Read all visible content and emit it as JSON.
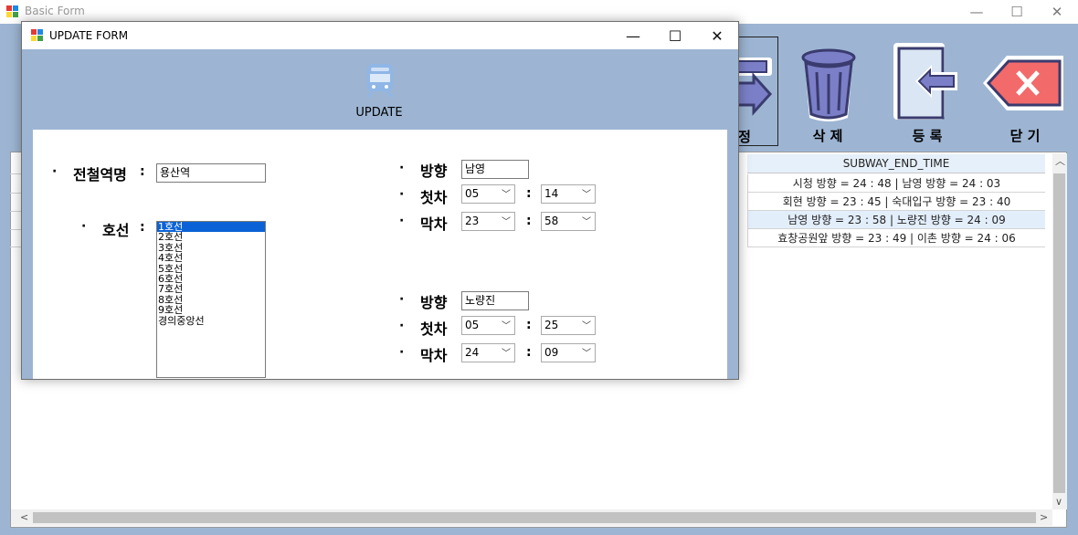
{
  "main_window": {
    "title": "Basic Form",
    "controls": {
      "minimize": "—",
      "maximize": "☐",
      "close": "✕"
    },
    "toolbar": [
      {
        "label": "정",
        "icon": "update-arrow-icon"
      },
      {
        "label": "삭 제",
        "icon": "trash-can-icon"
      },
      {
        "label": "등 록",
        "icon": "register-door-icon"
      },
      {
        "label": "닫 기",
        "icon": "close-x-icon"
      }
    ],
    "grid": {
      "column_header": "SUBWAY_END_TIME",
      "rows": [
        "시청 방향 = 24 : 48 | 남영 방향 = 24 : 03",
        "회현 방향 = 23 : 45 | 숙대입구 방향 = 23 : 40",
        "남영 방향 = 23 : 58 | 노량진 방향 = 24 : 09",
        "효창공원앞 방향 = 23 : 49 | 이촌 방향 = 24 : 06"
      ],
      "selected_row": 2
    },
    "scroll": {
      "left": "<",
      "right": ">",
      "up": "︿",
      "down": "∨"
    }
  },
  "update_form": {
    "title": "UPDATE FORM",
    "controls": {
      "minimize": "—",
      "maximize": "☐",
      "close": "✕"
    },
    "header_label": "UPDATE",
    "station_label": "전철역명",
    "station_value": "용산역",
    "line_label": "호선",
    "lines": [
      "1호선",
      "2호선",
      "3호선",
      "4호선",
      "5호선",
      "6호선",
      "7호선",
      "8호선",
      "9호선",
      "경의중앙선"
    ],
    "selected_line": "1호선",
    "bullet": "·",
    "colon": ":",
    "direction_label": "방향",
    "first_label": "첫차",
    "last_label": "막차",
    "direction1": {
      "name": "남영",
      "first_hour": "05",
      "first_min": "14",
      "last_hour": "23",
      "last_min": "58"
    },
    "direction2": {
      "name": "노량진",
      "first_hour": "05",
      "first_min": "25",
      "last_hour": "24",
      "last_min": "09"
    }
  }
}
